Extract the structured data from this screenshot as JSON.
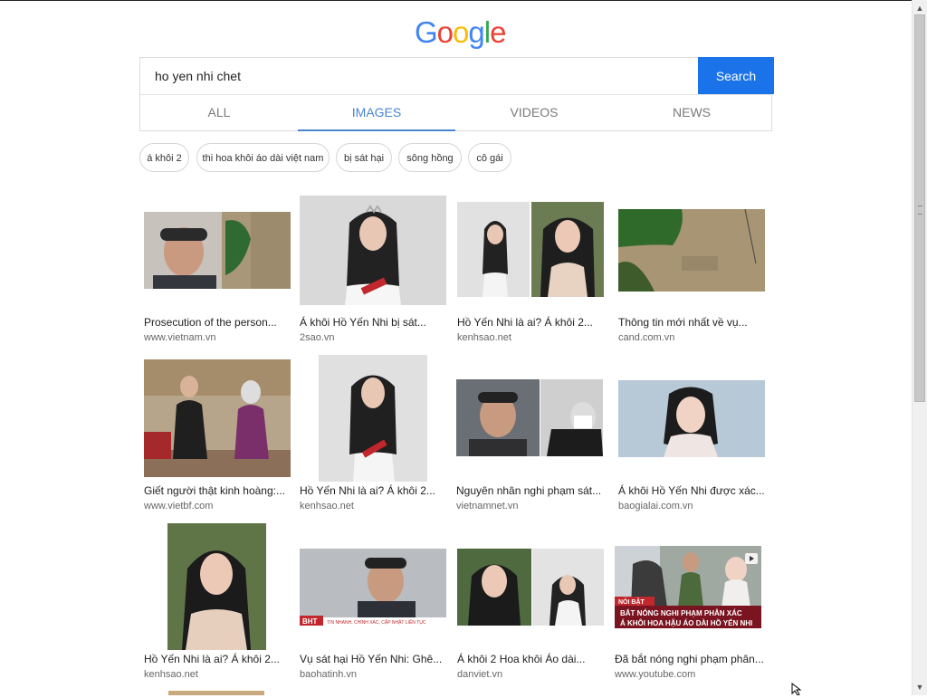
{
  "logo": {
    "letters": [
      "G",
      "o",
      "o",
      "g",
      "l",
      "e"
    ],
    "colors": [
      "#4285F4",
      "#EA4335",
      "#FBBC05",
      "#4285F4",
      "#34A853",
      "#EA4335"
    ]
  },
  "search": {
    "value": "ho yen nhi chet",
    "button_label": "Search"
  },
  "tabs": [
    {
      "label": "ALL",
      "active": false
    },
    {
      "label": "IMAGES",
      "active": true
    },
    {
      "label": "VIDEOS",
      "active": false
    },
    {
      "label": "NEWS",
      "active": false
    }
  ],
  "chips": [
    "á khôi 2",
    "thi hoa khôi áo dài việt nam",
    "bị sát hại",
    "sông hồng",
    "cô gái"
  ],
  "results": [
    {
      "title": "Prosecution of the person...",
      "source": "www.vietnam.vn"
    },
    {
      "title": "Á khôi Hồ Yến Nhi bị sát...",
      "source": "2sao.vn"
    },
    {
      "title": "Hồ Yến Nhi là ai? Á khôi 2...",
      "source": "kenhsao.net"
    },
    {
      "title": "Thông tin mới nhất về vụ...",
      "source": "cand.com.vn"
    },
    {
      "title": "Giết người thật kinh hoàng:...",
      "source": "www.vietbf.com"
    },
    {
      "title": "Hồ Yến Nhi là ai? Á khôi 2...",
      "source": "kenhsao.net"
    },
    {
      "title": "Nguyên nhân nghi phạm sát...",
      "source": "vietnamnet.vn"
    },
    {
      "title": "Á khôi Hồ Yến Nhi được xác...",
      "source": "baogialai.com.vn"
    },
    {
      "title": "Hồ Yến Nhi là ai? Á khôi 2...",
      "source": "kenhsao.net"
    },
    {
      "title": "Vụ sát hại Hồ Yến Nhi: Ghê...",
      "source": "baohatinh.vn"
    },
    {
      "title": "Á khôi 2 Hoa khôi Áo dài...",
      "source": "danviet.vn"
    },
    {
      "title": "Đã bắt nóng nghi phạm phân...",
      "source": "www.youtube.com"
    }
  ],
  "thumb_text": {
    "r10_logo": "BHT",
    "r10_tag": "TIN NHANH, CHÍNH XÁC, CẬP NHẬT LIÊN TỤC",
    "r12_badge": "NÓI BẬT",
    "r12_line1": "BẮT NÓNG NGHI PHẠM PHÂN XÁC",
    "r12_line2": "Á KHÔI HOA HẬU ÁO DÀI HỒ YẾN NHI"
  },
  "colors": {
    "accent": "#1a73e8",
    "tab_active": "#4a85cf"
  }
}
